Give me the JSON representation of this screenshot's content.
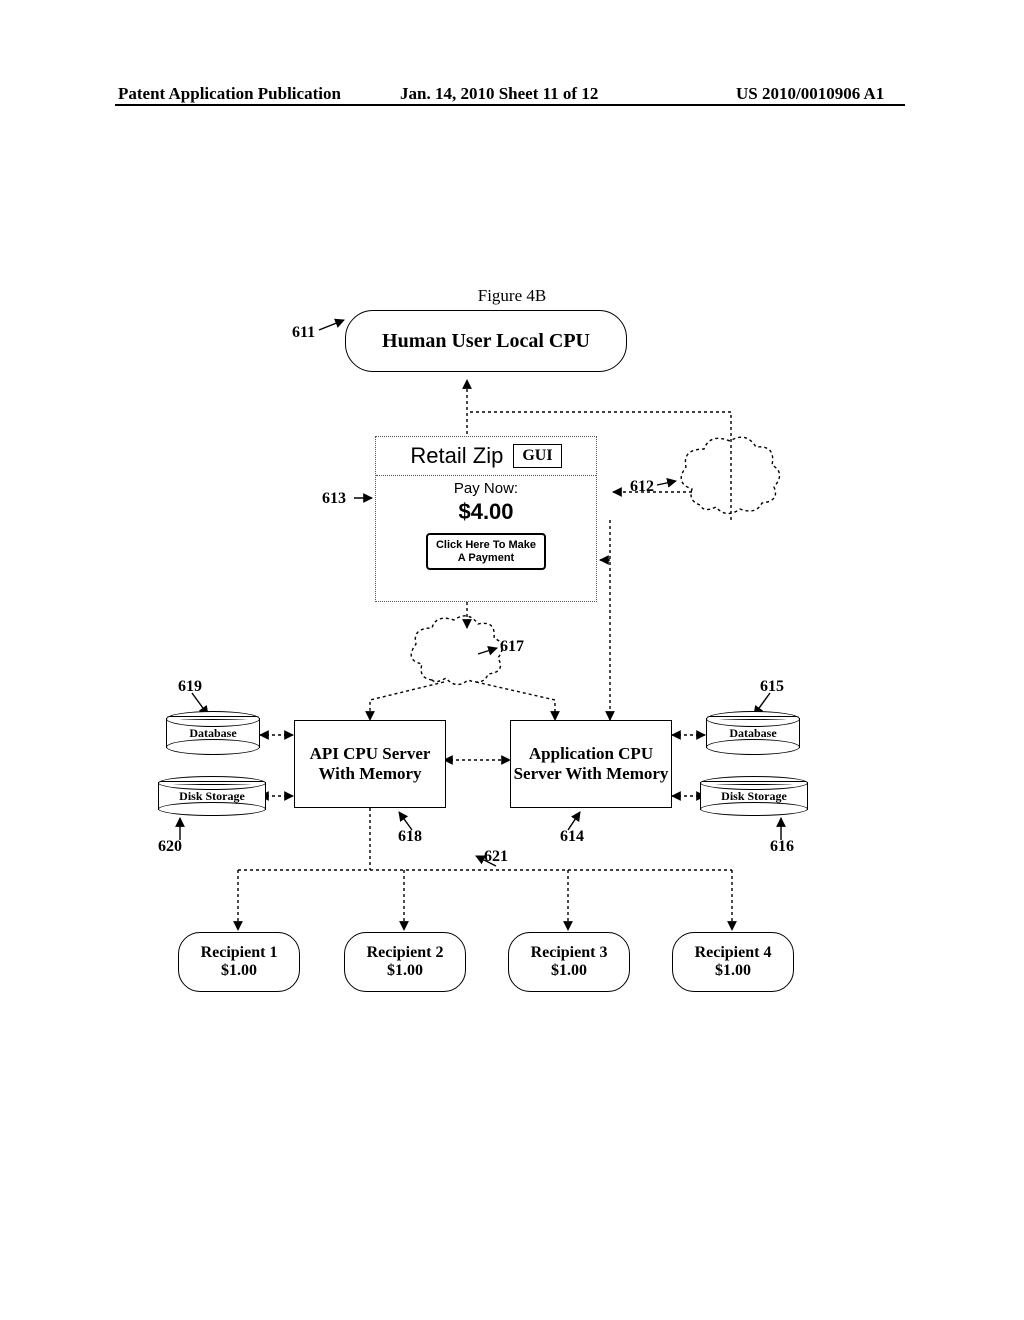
{
  "header": {
    "left": "Patent Application Publication",
    "center": "Jan. 14, 2010  Sheet 11 of 12",
    "right": "US 2010/0010906 A1"
  },
  "figure_title": "Figure 4B",
  "nodes": {
    "cpu611": "Human User Local CPU",
    "gui613": {
      "brand": "Retail Zip",
      "gui_label": "GUI",
      "pay_now": "Pay Now:",
      "amount": "$4.00",
      "button_l1": "Click Here To Make",
      "button_l2": "A Payment"
    },
    "server618": "API CPU Server With Memory",
    "server614": "Application CPU Server With Memory",
    "db_left": "Database",
    "disk_left": "Disk Storage",
    "db_right": "Database",
    "disk_right": "Disk Storage",
    "recipients": [
      {
        "title": "Recipient 1",
        "amount": "$1.00"
      },
      {
        "title": "Recipient 2",
        "amount": "$1.00"
      },
      {
        "title": "Recipient 3",
        "amount": "$1.00"
      },
      {
        "title": "Recipient 4",
        "amount": "$1.00"
      }
    ]
  },
  "refs": {
    "r611": "611",
    "r612": "612",
    "r613": "613",
    "r614": "614",
    "r615": "615",
    "r616": "616",
    "r617": "617",
    "r618": "618",
    "r619": "619",
    "r620": "620",
    "r621": "621"
  }
}
